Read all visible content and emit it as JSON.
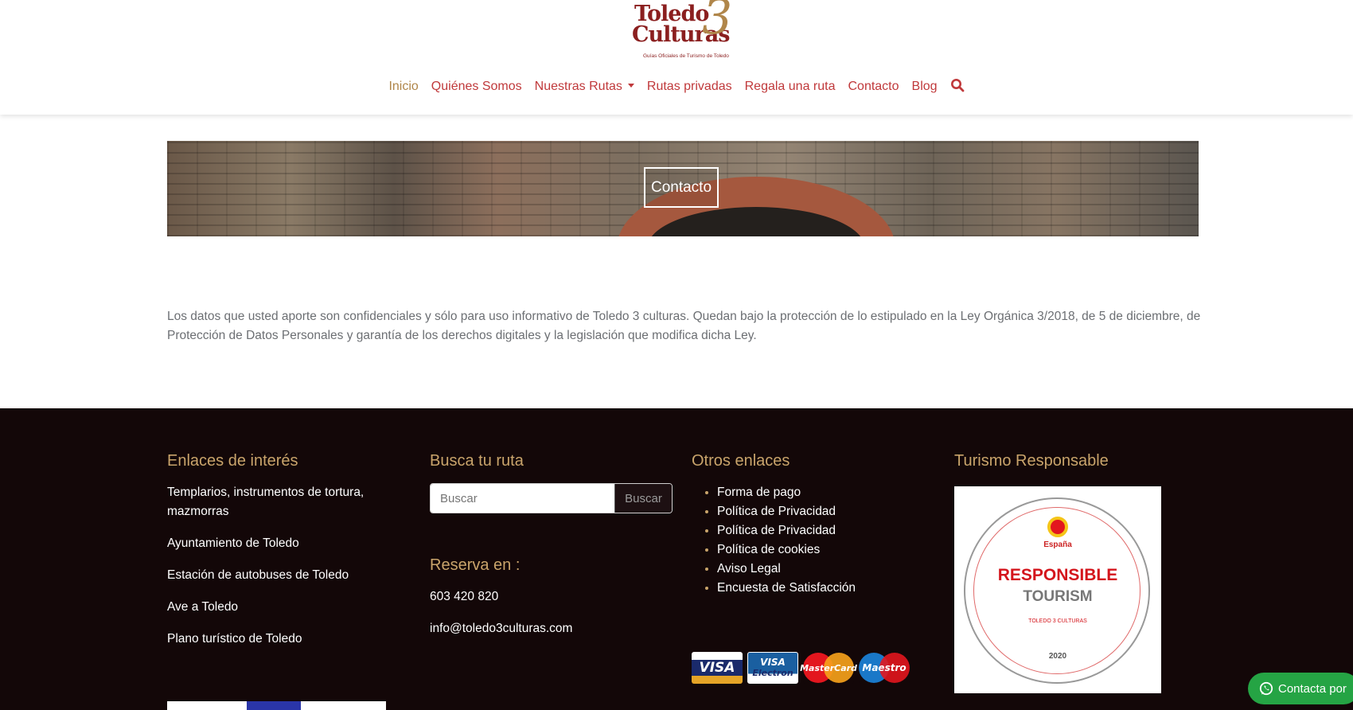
{
  "brand": {
    "line1": "Toledo",
    "line2": "Culturas",
    "number": "3",
    "tagline": "Guías Oficiales de Turismo de Toledo"
  },
  "nav": {
    "items": [
      {
        "label": "Inicio",
        "active": true
      },
      {
        "label": "Quiénes Somos"
      },
      {
        "label": "Nuestras Rutas",
        "dropdown": true
      },
      {
        "label": "Rutas privadas"
      },
      {
        "label": "Regala una ruta"
      },
      {
        "label": "Contacto"
      },
      {
        "label": "Blog"
      }
    ],
    "search_icon": "search-icon"
  },
  "banner": {
    "button_label": "Contacto"
  },
  "privacy_text": "Los datos que usted aporte son confidenciales y sólo para uso informativo de Toledo 3 culturas. Quedan bajo la protección de lo estipulado en la Ley Orgánica 3/2018, de 5 de diciembre, de Protección de Datos Personales y garantía de los derechos digitales y la legislación que modifica dicha Ley.",
  "footer": {
    "col1": {
      "title": "Enlaces de interés",
      "links": [
        "Templarios, instrumentos de tortura, mazmorras",
        "Ayuntamiento de Toledo",
        "Estación de autobuses de Toledo",
        "Ave a Toledo",
        "Plano turístico de Toledo"
      ]
    },
    "col2": {
      "title": "Busca tu ruta",
      "search_placeholder": "Buscar",
      "search_button": "Buscar",
      "reserva_title": "Reserva en :",
      "phone": "603 420 820",
      "email": "info@toledo3culturas.com"
    },
    "col3": {
      "title": "Otros enlaces",
      "links": [
        "Forma de pago",
        "Política de Privacidad",
        "Política de Privacidad",
        "Política de cookies",
        "Aviso Legal",
        "Encuesta de Satisfacción"
      ],
      "cards": {
        "visa": "VISA",
        "electron_top": "VISA",
        "electron_bottom": "Electron",
        "mastercard": "MasterCard",
        "maestro": "Maestro"
      }
    },
    "col4": {
      "title": "Turismo Responsable",
      "badge": {
        "espana": "España",
        "line1": "RESPONSIBLE",
        "line2": "TOURISM",
        "line3": "TOLEDO 3 CULTURAS",
        "year": "2020"
      }
    }
  },
  "whatsapp": {
    "label": "Contacta por"
  },
  "colors": {
    "nav_link": "#c0393b",
    "nav_active": "#b0864a",
    "footer_bg": "#130708",
    "footer_heading": "#c9a46b",
    "whatsapp": "#25a444"
  }
}
